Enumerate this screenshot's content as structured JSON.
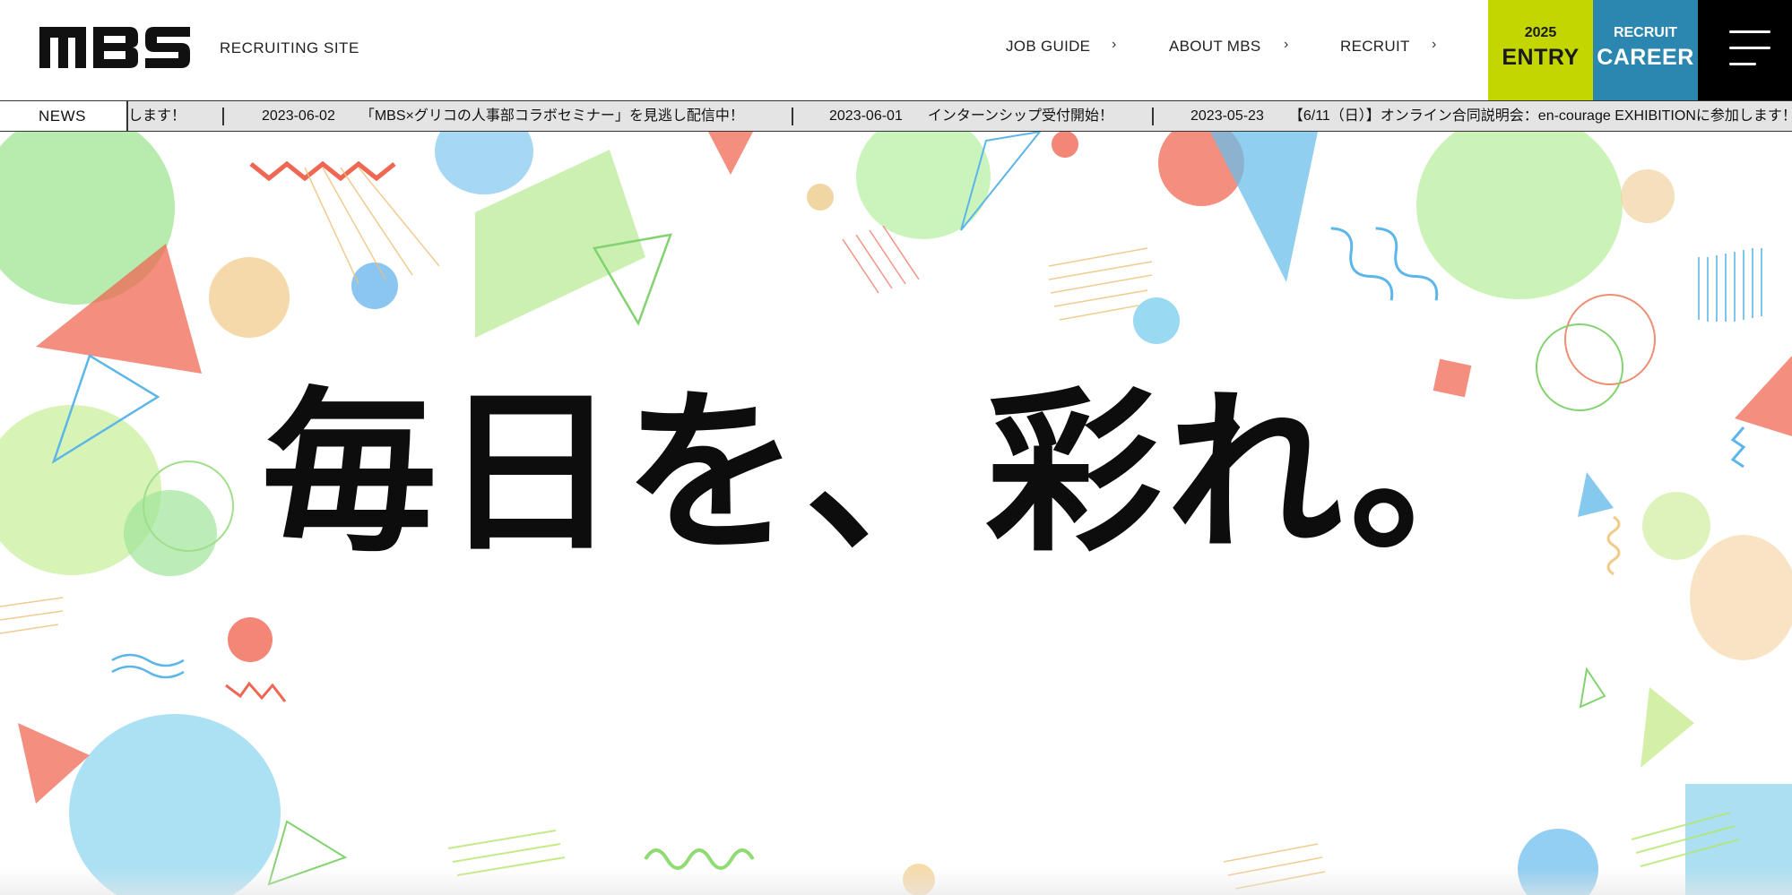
{
  "header": {
    "logo_text": "MBS",
    "site_label": "RECRUITING SITE",
    "nav": [
      {
        "label": "JOB GUIDE",
        "icon": "chevron-right-icon"
      },
      {
        "label": "ABOUT MBS",
        "icon": "chevron-right-icon"
      },
      {
        "label": "RECRUIT",
        "icon": "chevron-right-icon"
      }
    ],
    "entry": {
      "small": "2025",
      "big": "ENTRY",
      "color": "#c3d600"
    },
    "career": {
      "small": "RECRUIT",
      "big": "CAREER",
      "color": "#2b86b0"
    },
    "menu_icon": "hamburger-menu-icon"
  },
  "news": {
    "label": "NEWS",
    "partial_tail": "します！",
    "items": [
      {
        "date": "2023-06-02",
        "title": "「MBS×グリコの人事部コラボセミナー」を見逃し配信中！"
      },
      {
        "date": "2023-06-01",
        "title": "インターンシップ受付開始！"
      },
      {
        "date": "2023-05-23",
        "title": "【6/11（日）】オンライン合同説明会：en-courage EXHIBITIONに参加します！"
      }
    ]
  },
  "hero": {
    "headline": "毎日を、彩れ。"
  },
  "colors": {
    "ticker_bg": "#e4e4e4",
    "menu_bg": "#000000"
  }
}
